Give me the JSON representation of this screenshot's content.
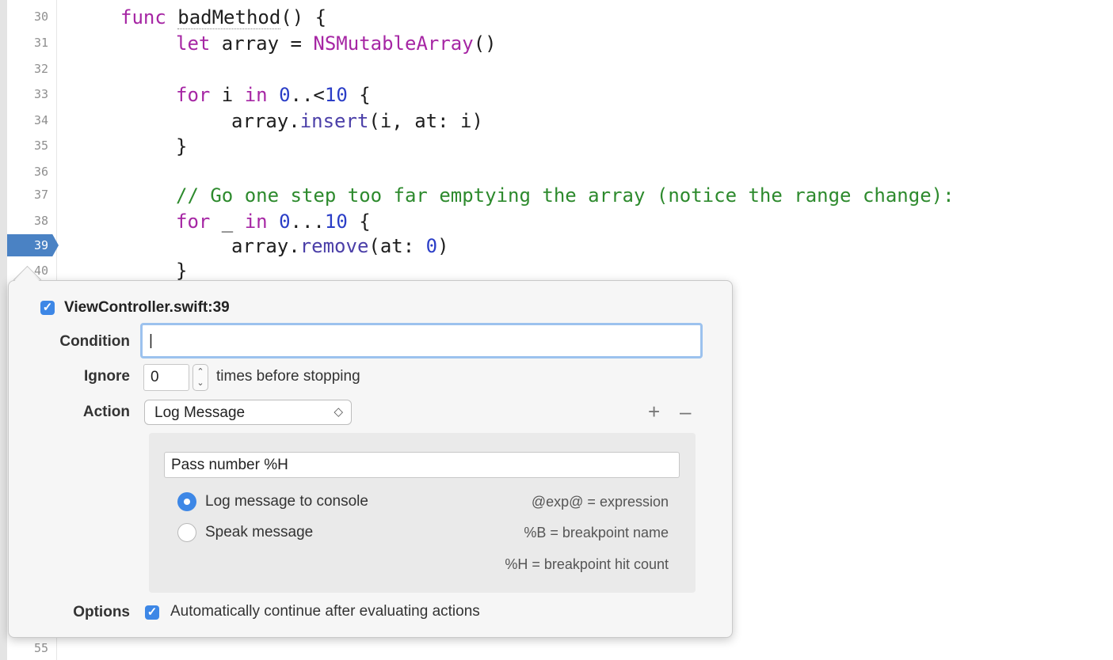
{
  "editor": {
    "line_numbers": [
      "30",
      "31",
      "32",
      "33",
      "34",
      "35",
      "36",
      "37",
      "38",
      "39",
      "40",
      "55"
    ],
    "code": {
      "l30_kw": "func",
      "l30_name": "badMethod",
      "l30_rest": "() {",
      "l31_kw": "let",
      "l31_mid": " array = ",
      "l31_type": "NSMutableArray",
      "l31_end": "()",
      "l33_kw": "for",
      "l33_mid": " i ",
      "l33_in": "in",
      "l33_sp": " ",
      "l33_n0": "0",
      "l33_op": "..<",
      "l33_n10": "10",
      "l33_end": " {",
      "l34_pre": "array.",
      "l34_fn": "insert",
      "l34_end": "(i, at: i)",
      "l35": "}",
      "l37_comment": "// Go one step too far emptying the array (notice the range change):",
      "l38_kw": "for",
      "l38_mid": " _ ",
      "l38_in": "in",
      "l38_sp": " ",
      "l38_n0": "0",
      "l38_op": "...",
      "l38_n10": "10",
      "l38_end": " {",
      "l39_pre": "array.",
      "l39_fn": "remove",
      "l39_mid": "(at: ",
      "l39_n": "0",
      "l39_end": ")",
      "l40": "}"
    }
  },
  "popover": {
    "title": "ViewController.swift:39",
    "enabled_check": "✓",
    "condition_label": "Condition",
    "condition_value": "|",
    "ignore_label": "Ignore",
    "ignore_value": "0",
    "stepper_up": "⌃",
    "stepper_down": "⌄",
    "ignore_suffix": "times before stopping",
    "action_label": "Action",
    "action_value": "Log Message",
    "popup_arrows": "◇",
    "add_label": "+",
    "remove_label": "–",
    "message_value": "Pass number %H",
    "radio_log": "Log message to console",
    "radio_speak": "Speak message",
    "radio_selected": "log",
    "hint_exp": "@exp@ = expression",
    "hint_b": "%B = breakpoint name",
    "hint_h": "%H = breakpoint hit count",
    "options_label": "Options",
    "options_check": "✓",
    "options_text": "Automatically continue after evaluating actions"
  },
  "colors": {
    "accent": "#3d87e6",
    "breakpoint": "#4a82c4",
    "keyword": "#a626a4",
    "number": "#2b3ec7",
    "comment": "#2d8a2d"
  }
}
